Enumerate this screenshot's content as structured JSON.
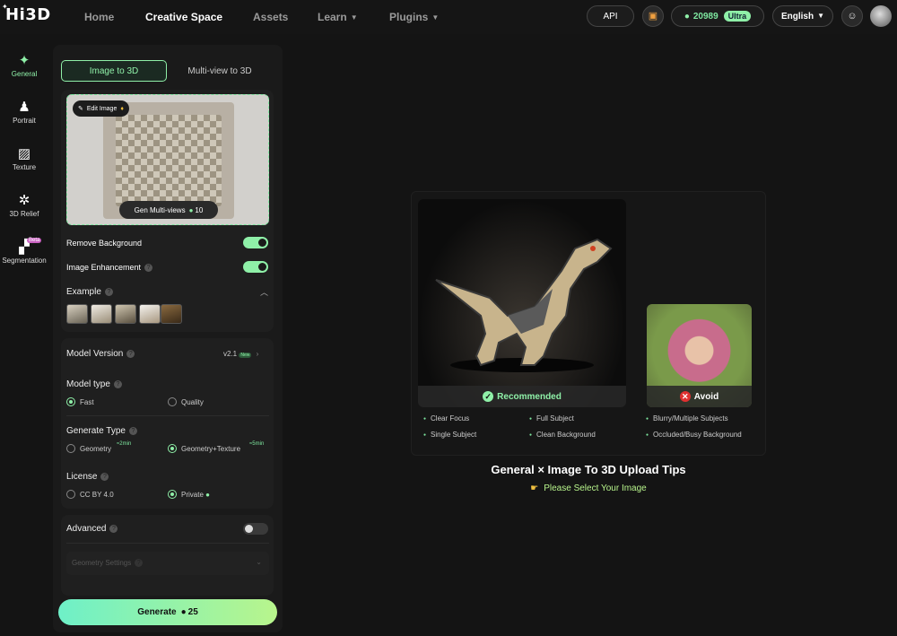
{
  "header": {
    "logo": "Hi3D",
    "nav": [
      {
        "label": "Home"
      },
      {
        "label": "Creative Space"
      },
      {
        "label": "Assets"
      },
      {
        "label": "Learn"
      },
      {
        "label": "Plugins"
      }
    ],
    "api_label": "API",
    "credits": "20989",
    "plan": "Ultra",
    "language": "English"
  },
  "sidebar": {
    "items": [
      {
        "label": "General"
      },
      {
        "label": "Portrait"
      },
      {
        "label": "Texture"
      },
      {
        "label": "3D Relief"
      },
      {
        "label": "Segmentation",
        "badge": "Beta"
      }
    ]
  },
  "panel": {
    "tabs": [
      "Image to 3D",
      "Multi-view to 3D"
    ],
    "edit_image": "Edit Image",
    "gen_multiviews": "Gen Multi-views",
    "gen_multiviews_cost": "10",
    "remove_background": "Remove Background",
    "image_enhancement": "Image Enhancement",
    "example": "Example",
    "model_version_label": "Model Version",
    "model_version_value": "v2.1",
    "model_version_badge": "New",
    "model_type_label": "Model type",
    "model_type_options": [
      "Fast",
      "Quality"
    ],
    "generate_type_label": "Generate Type",
    "generate_type_options": [
      {
        "label": "Geometry",
        "time": "≈2min"
      },
      {
        "label": "Geometry+Texture",
        "time": "≈5min"
      }
    ],
    "license_label": "License",
    "license_options": [
      "CC BY 4.0",
      "Private"
    ],
    "advanced_label": "Advanced",
    "geometry_settings": "Geometry Settings",
    "generate_label": "Generate",
    "generate_cost": "25"
  },
  "tips": {
    "recommended": "Recommended",
    "avoid": "Avoid",
    "recommended_points": [
      "Clear Focus",
      "Full Subject",
      "Single Subject",
      "Clean Background"
    ],
    "avoid_points": [
      "Blurry/Multiple Subjects",
      "Occluded/Busy Background"
    ],
    "title": "General × Image To 3D Upload Tips",
    "subtitle": "Please Select Your Image"
  },
  "colors": {
    "accent": "#8ff0a8",
    "background": "#141414",
    "panel": "#1a1a1a"
  }
}
